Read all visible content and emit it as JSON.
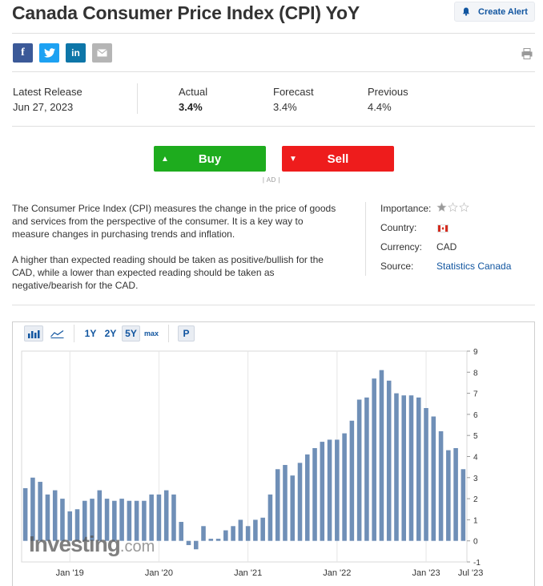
{
  "header": {
    "title": "Canada Consumer Price Index (CPI) YoY",
    "create_alert": "Create Alert"
  },
  "share": {
    "facebook": "f",
    "linkedin": "in"
  },
  "release": {
    "latest_label": "Latest Release",
    "latest_value": "Jun 27, 2023",
    "actual_label": "Actual",
    "actual_value": "3.4%",
    "forecast_label": "Forecast",
    "forecast_value": "3.4%",
    "previous_label": "Previous",
    "previous_value": "4.4%"
  },
  "trade": {
    "buy_label": "Buy",
    "sell_label": "Sell",
    "ad_label": "| AD |"
  },
  "description": {
    "p1": "The Consumer Price Index (CPI) measures the change in the price of goods and services from the perspective of the consumer. It is a key way to measure changes in purchasing trends and inflation.",
    "p2": "A higher than expected reading should be taken as positive/bullish for the CAD, while a lower than expected reading should be taken as negative/bearish for the CAD."
  },
  "meta": {
    "importance_label": "Importance:",
    "importance_stars": 1,
    "importance_max": 3,
    "country_label": "Country:",
    "currency_label": "Currency:",
    "currency_value": "CAD",
    "source_label": "Source:",
    "source_value": "Statistics Canada"
  },
  "chart_toolbar": {
    "r1y": "1Y",
    "r2y": "2Y",
    "r5y": "5Y",
    "rmax": "max",
    "p": "P"
  },
  "watermark": {
    "main": "Investing",
    "suffix": ".com"
  },
  "colors": {
    "bar": "#6f8fb7",
    "buy": "#1eac1e",
    "sell": "#ee1c1c",
    "link": "#1256a0"
  },
  "chart_data": {
    "type": "bar",
    "title": "",
    "xlabel": "",
    "ylabel": "",
    "ylim": [
      -1,
      9
    ],
    "yticks": [
      9,
      8,
      7,
      6,
      5,
      4,
      3,
      2,
      1,
      0,
      -1
    ],
    "grid": "vertical",
    "x_start": "2018-07",
    "x_tick_labels": [
      {
        "label": "Jan '19",
        "month": "2019-01"
      },
      {
        "label": "Jan '20",
        "month": "2020-01"
      },
      {
        "label": "Jan '21",
        "month": "2021-01"
      },
      {
        "label": "Jan '22",
        "month": "2022-01"
      },
      {
        "label": "Jan '23",
        "month": "2023-01"
      },
      {
        "label": "Jul '23",
        "month": "2023-07"
      }
    ],
    "values": [
      2.5,
      3.0,
      2.8,
      2.2,
      2.4,
      2.0,
      1.4,
      1.5,
      1.9,
      2.0,
      2.4,
      2.0,
      1.9,
      2.0,
      1.9,
      1.9,
      1.9,
      2.2,
      2.2,
      2.4,
      2.2,
      0.9,
      -0.2,
      -0.4,
      0.7,
      0.1,
      0.1,
      0.5,
      0.7,
      1.0,
      0.7,
      1.0,
      1.1,
      2.2,
      3.4,
      3.6,
      3.1,
      3.7,
      4.1,
      4.4,
      4.7,
      4.8,
      4.8,
      5.1,
      5.7,
      6.7,
      6.8,
      7.7,
      8.1,
      7.6,
      7.0,
      6.9,
      6.9,
      6.8,
      6.3,
      5.9,
      5.2,
      4.3,
      4.4,
      3.4
    ]
  }
}
